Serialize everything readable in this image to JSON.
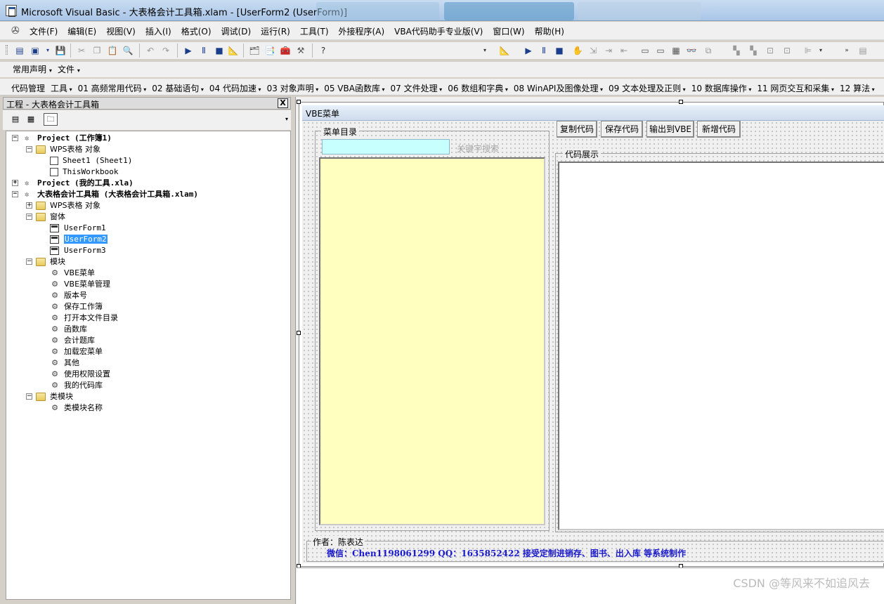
{
  "window": {
    "title": "Microsoft Visual Basic - 大表格会计工具箱.xlam - [UserForm2 (UserForm)]"
  },
  "menubar": {
    "items": [
      "文件(F)",
      "编辑(E)",
      "视图(V)",
      "插入(I)",
      "格式(O)",
      "调试(D)",
      "运行(R)",
      "工具(T)",
      "外接程序(A)",
      "VBA代码助手专业版(V)",
      "窗口(W)",
      "帮助(H)"
    ]
  },
  "toolbar2": {
    "common_decl": "常用声明",
    "file": "文件"
  },
  "toolbar3": {
    "items": [
      "代码管理",
      "工具",
      "01 高频常用代码",
      "02 基础语句",
      "04 代码加速",
      "03 对象声明",
      "05 VBA函数库",
      "07 文件处理",
      "06 数组和字典",
      "08 WinAPI及图像处理",
      "09 文本处理及正则",
      "10 数据库操作",
      "11 网页交互和采集",
      "12 算法"
    ]
  },
  "project_panel": {
    "title": "工程 - 大表格会计工具箱",
    "close": "X"
  },
  "tree": {
    "project1": "Project (工作簿1)",
    "wps_objects1": "WPS表格 对象",
    "sheet1": "Sheet1 (Sheet1)",
    "thisworkbook": "ThisWorkbook",
    "project2": "Project (我的工具.xla)",
    "project3": "大表格会计工具箱 (大表格会计工具箱.xlam)",
    "wps_objects3": "WPS表格 对象",
    "forms": "窗体",
    "userform1": "UserForm1",
    "userform2": "UserForm2",
    "userform3": "UserForm3",
    "modules": "模块",
    "module_items": [
      "VBE菜单",
      "VBE菜单管理",
      "版本号",
      "保存工作簿",
      "打开本文件目录",
      "函数库",
      "会计题库",
      "加载宏菜单",
      "其他",
      "使用权限设置",
      "我的代码库"
    ],
    "class_modules": "类模块",
    "class_module_name": "类模块名称"
  },
  "form": {
    "caption": "VBE菜单",
    "menu_frame_label": "菜单目录",
    "search_hint": "关键字搜索",
    "buttons": [
      "复制代码",
      "保存代码",
      "输出到VBE",
      "新增代码"
    ],
    "code_frame_label": "代码展示",
    "author_label": "作者：陈表达",
    "footer": "微信：Chen1198061299     QQ：1635852422       接受定制进销存、图书、出入库 等系统制作"
  },
  "watermark": "CSDN @等风来不如追风去"
}
